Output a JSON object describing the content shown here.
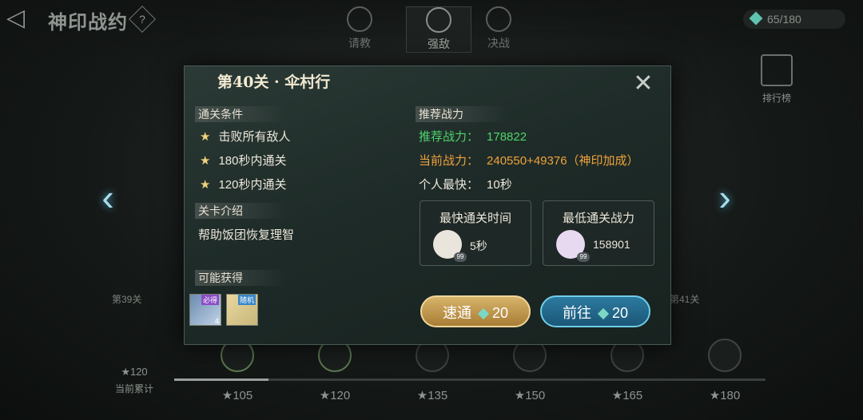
{
  "header": {
    "title": "神印战约",
    "help": "?",
    "tabs": [
      {
        "label": "请教"
      },
      {
        "label": "强敌"
      },
      {
        "label": "决战"
      }
    ],
    "energy": "65/180"
  },
  "ranking": {
    "label": "排行榜"
  },
  "side": {
    "left_stage": "第39关",
    "right_stage": "第41关"
  },
  "dialog": {
    "title": "第40关 · 伞村行",
    "clear_conditions": {
      "heading": "通关条件",
      "items": [
        "击败所有敌人",
        "180秒内通关",
        "120秒内通关"
      ]
    },
    "intro": {
      "heading": "关卡介绍",
      "text": "帮助饭团恢复理智"
    },
    "rewards": {
      "heading": "可能获得",
      "items": [
        {
          "tag": "必得",
          "count": "4"
        },
        {
          "tag": "随机",
          "count": ""
        }
      ]
    },
    "power": {
      "heading": "推荐战力",
      "recommended_label": "推荐战力：",
      "recommended_value": "178822",
      "current_label": "当前战力：",
      "current_value": "240550+49376（神印加成）",
      "fastest_label": "个人最快：",
      "fastest_value": "10秒"
    },
    "fastest_clear": {
      "label": "最快通关时间",
      "value": "5秒",
      "level": "99"
    },
    "lowest_power": {
      "label": "最低通关战力",
      "value": "158901",
      "level": "99"
    },
    "buttons": {
      "sweep": "速通",
      "sweep_cost": "20",
      "go": "前往",
      "go_cost": "20"
    }
  },
  "progress": {
    "cumulative_value": "120",
    "cumulative_label": "当前累计",
    "milestones": [
      "105",
      "120",
      "135",
      "150",
      "165",
      "180"
    ],
    "filled_fraction": 0.16
  }
}
